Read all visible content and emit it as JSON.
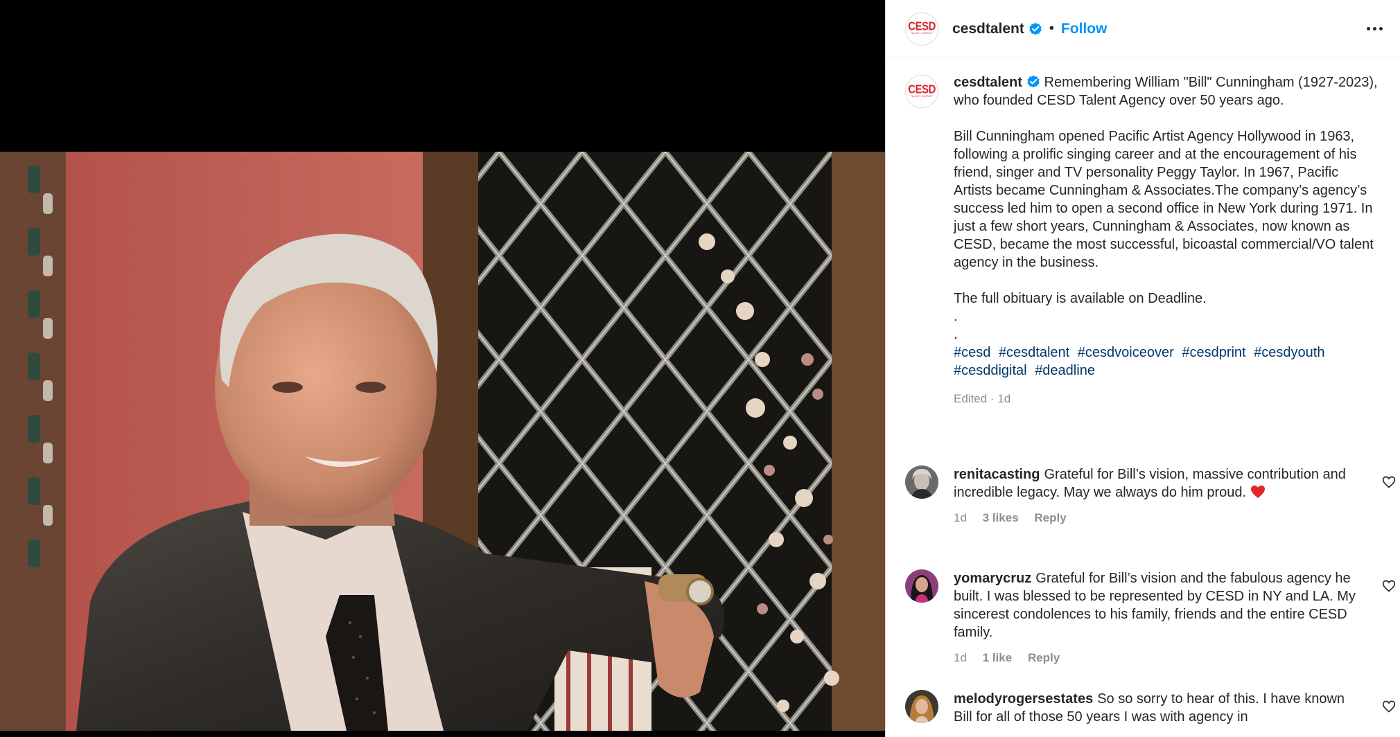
{
  "post": {
    "username": "cesdtalent",
    "follow_label": "Follow",
    "separator": "•",
    "avatar_logo": "CESD",
    "avatar_sub": "TALENT AGENCY"
  },
  "caption": {
    "username": "cesdtalent",
    "intro": "Remembering William \"Bill\" Cunningham (1927-2023), who founded CESD Talent Agency over 50 years ago.",
    "body": "Bill Cunningham opened Pacific Artist Agency Hollywood in 1963, following a prolific singing career and at the encouragement of his friend, singer and TV personality Peggy Taylor. In 1967, Pacific Artists became Cunningham & Associates.The company’s agency’s success led him to open a second office in New York during 1971. In just a few short years, Cunningham & Associates, now known as CESD, became the most successful, bicoastal commercial/VO talent agency in the business.",
    "obituary": "The full obituary is available on Deadline.",
    "dot1": ".",
    "dot2": ".",
    "hashtags": [
      "#cesd",
      "#cesdtalent",
      "#cesdvoiceover",
      "#cesdprint",
      "#cesdyouth",
      "#cesddigital",
      "#deadline"
    ],
    "meta": "Edited · 1d"
  },
  "comments": [
    {
      "username": "renitacasting",
      "text": "Grateful for Bill’s vision, massive contribution and incredible legacy. May we always do him proud.",
      "time": "1d",
      "likes": "3 likes",
      "reply": "Reply"
    },
    {
      "username": "yomarycruz",
      "text": "Grateful for Bill’s vision and the fabulous agency he built. I was blessed to be represented by CESD in NY and LA. My sincerest condolences to his family, friends and the entire CESD family.",
      "time": "1d",
      "likes": "1 like",
      "reply": "Reply"
    },
    {
      "username": "melodyrogersestates",
      "text": "So so sorry to hear of this. I have known Bill for all of those 50 years I was with agency in"
    }
  ],
  "colors": {
    "accent": "#0095f6",
    "verified": "#0095f6",
    "hashtag": "#00376b",
    "logo": "#d6262d",
    "muted": "#8e8e8e"
  },
  "icons": {
    "verified": "verified-badge-icon",
    "more": "more-options-icon",
    "heart": "heart-outline-icon",
    "emoji": "red-heart-emoji-icon"
  }
}
